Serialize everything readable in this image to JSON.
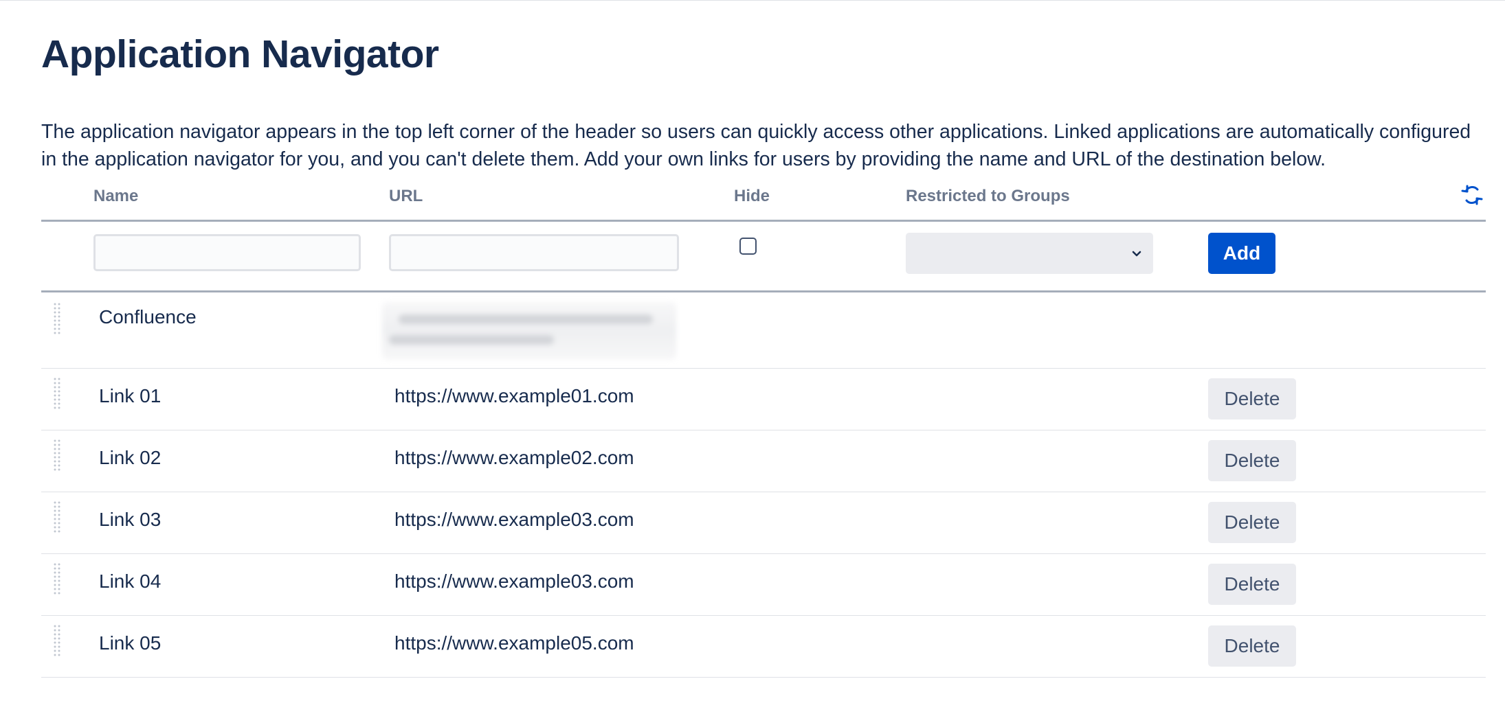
{
  "page": {
    "title": "Application Navigator",
    "description": "The application navigator appears in the top left corner of the header so users can quickly access other applications. Linked applications are automatically configured in the application navigator for you, and you can't delete them. Add your own links for users by providing the name and URL of the destination below."
  },
  "table": {
    "headers": {
      "name": "Name",
      "url": "URL",
      "hide": "Hide",
      "groups": "Restricted to Groups"
    },
    "refresh_icon": "refresh-icon"
  },
  "add_form": {
    "name_value": "",
    "url_value": "",
    "hide_checked": false,
    "groups_selected": "",
    "add_label": "Add"
  },
  "rows": [
    {
      "name": "Confluence",
      "url": "",
      "url_obscured": true,
      "deletable": false
    },
    {
      "name": "Link 01",
      "url": "https://www.example01.com",
      "delete_label": "Delete"
    },
    {
      "name": "Link 02",
      "url": "https://www.example02.com",
      "delete_label": "Delete"
    },
    {
      "name": "Link 03",
      "url": "https://www.example03.com",
      "delete_label": "Delete"
    },
    {
      "name": "Link 04",
      "url": "https://www.example03.com",
      "delete_label": "Delete"
    },
    {
      "name": "Link 05",
      "url": "https://www.example05.com",
      "delete_label": "Delete"
    }
  ],
  "colors": {
    "primary": "#0052cc",
    "text": "#172b4d",
    "header_text": "#6b778c",
    "subtle_bg": "#ebecf0"
  }
}
